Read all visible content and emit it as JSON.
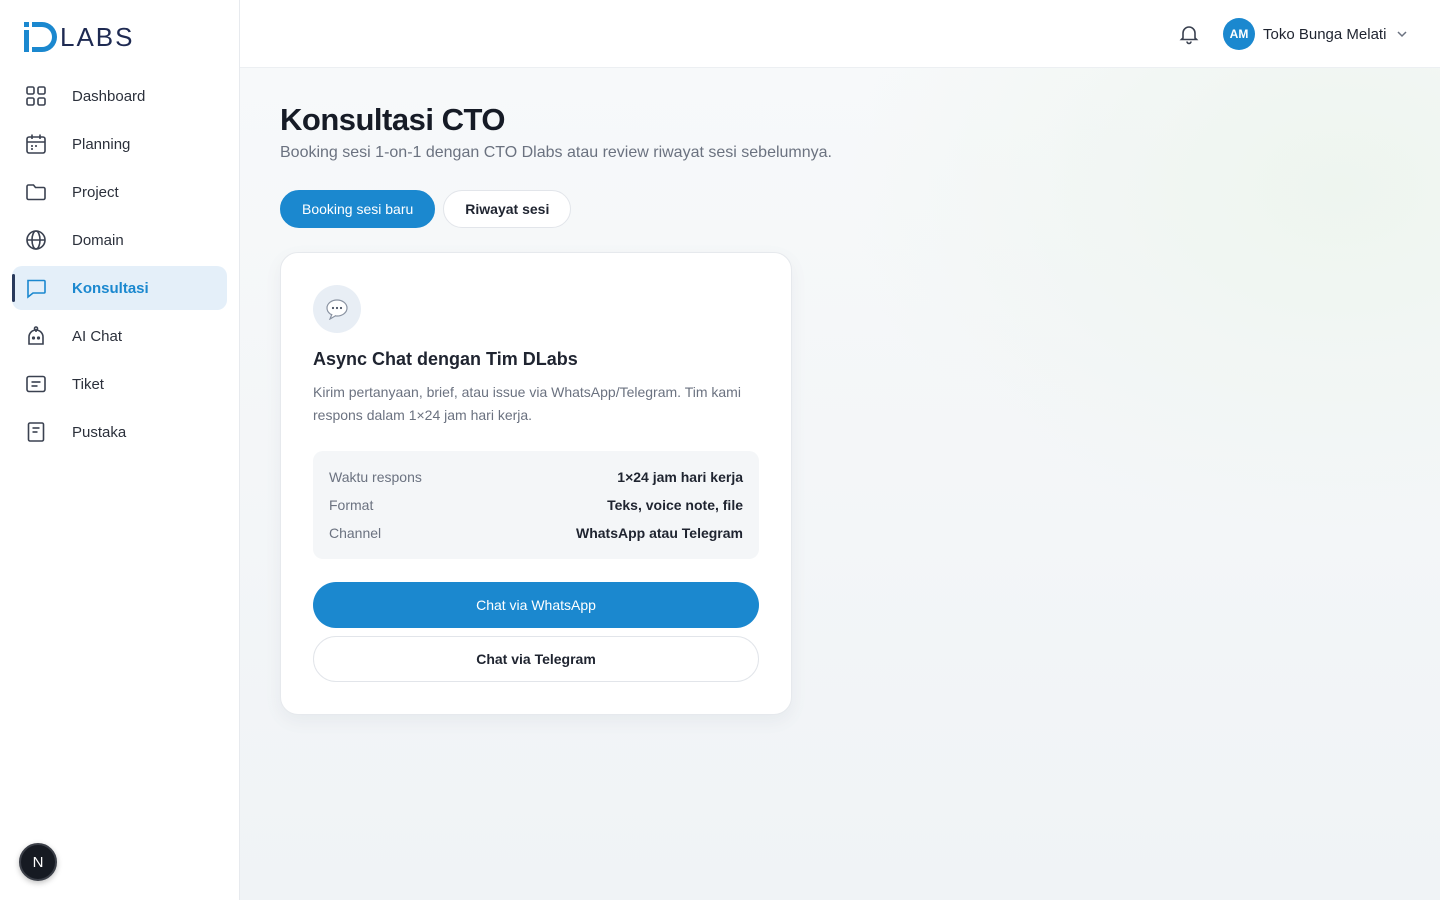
{
  "app": {
    "logo_text": "LABS",
    "user_initials": "AM",
    "user_name": "Toko Bunga Melati",
    "next_badge": "N"
  },
  "sidebar": {
    "items": [
      {
        "label": "Dashboard",
        "icon": "grid-icon"
      },
      {
        "label": "Planning",
        "icon": "calendar-icon"
      },
      {
        "label": "Project",
        "icon": "folder-icon"
      },
      {
        "label": "Domain",
        "icon": "globe-icon"
      },
      {
        "label": "Konsultasi",
        "icon": "chat-bubble-icon",
        "active": true
      },
      {
        "label": "AI Chat",
        "icon": "bot-icon"
      },
      {
        "label": "Tiket",
        "icon": "ticket-icon"
      },
      {
        "label": "Pustaka",
        "icon": "book-icon"
      }
    ]
  },
  "page": {
    "title": "Konsultasi CTO",
    "subtitle": "Booking sesi 1-on-1 dengan CTO Dlabs atau review riwayat sesi sebelumnya.",
    "tabs": [
      {
        "label": "Booking sesi baru",
        "active": true
      },
      {
        "label": "Riwayat sesi",
        "active": false
      }
    ]
  },
  "card": {
    "icon": "speech-balloon-icon",
    "title": "Async Chat dengan Tim DLabs",
    "description": "Kirim pertanyaan, brief, atau issue via WhatsApp/Telegram. Tim kami respons dalam 1×24 jam hari kerja.",
    "info": [
      {
        "key": "Waktu respons",
        "value": "1×24 jam hari kerja"
      },
      {
        "key": "Format",
        "value": "Teks, voice note, file"
      },
      {
        "key": "Channel",
        "value": "WhatsApp atau Telegram"
      }
    ],
    "primary_button": "Chat via WhatsApp",
    "secondary_button": "Chat via Telegram"
  },
  "colors": {
    "accent": "#1b88cf",
    "active_bg": "#e4eff9",
    "logo": "#1e2a52"
  }
}
